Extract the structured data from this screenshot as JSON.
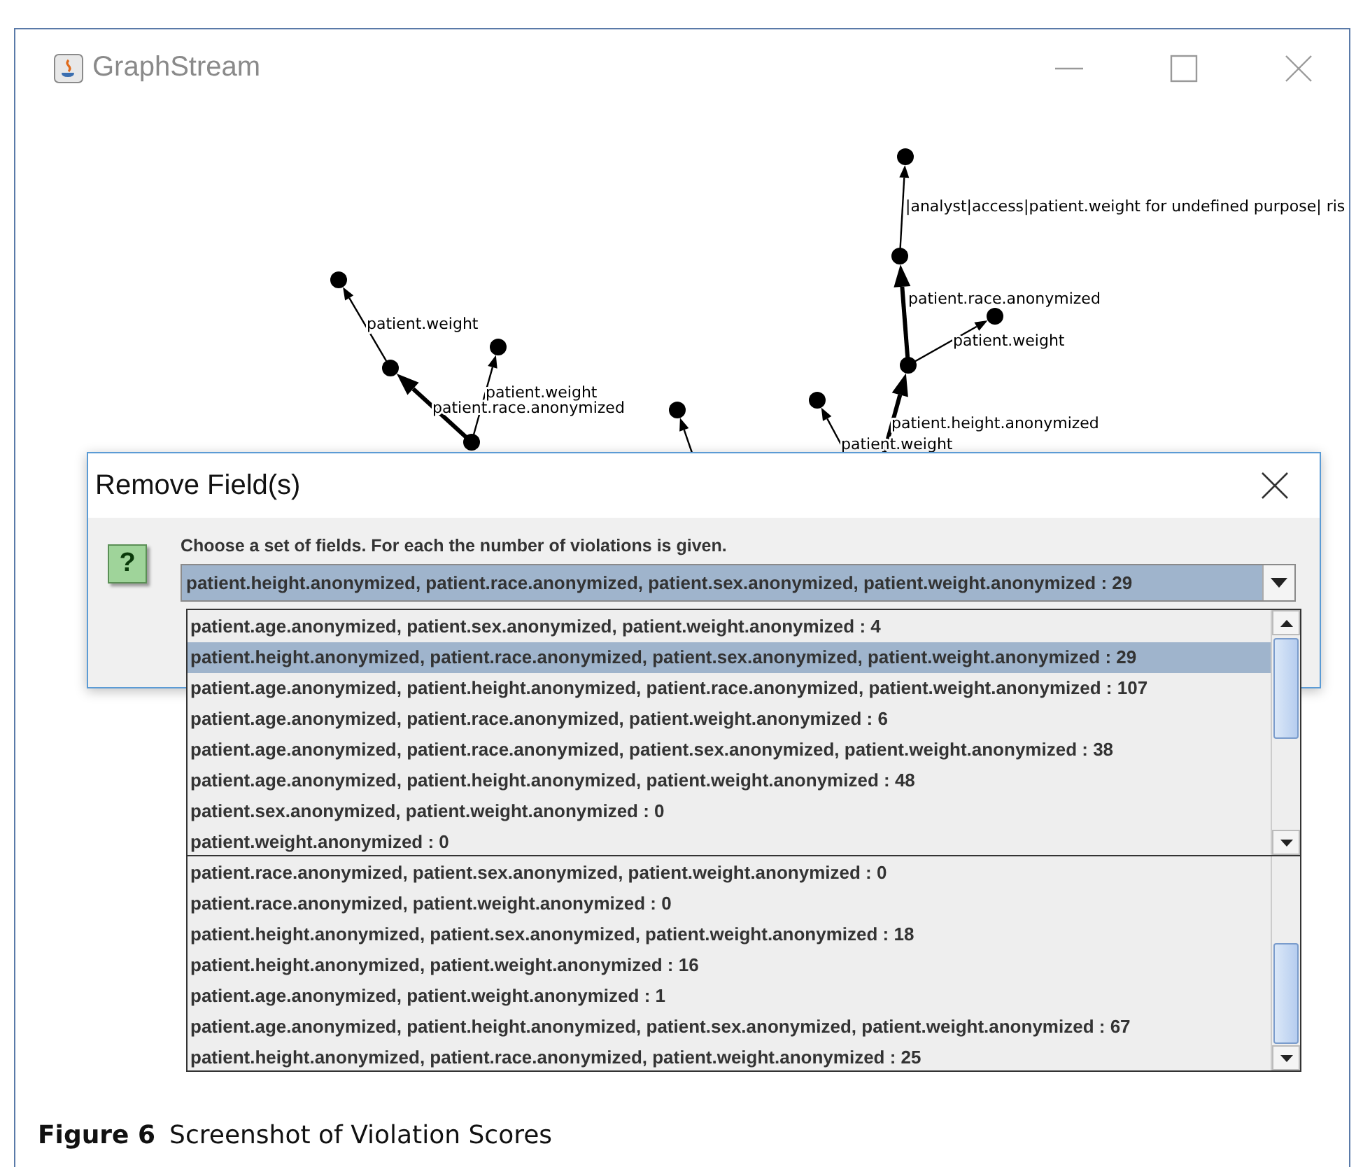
{
  "window": {
    "title": "GraphStream"
  },
  "graph": {
    "edge_labels": [
      "patient.weight",
      "patient.weight",
      "patient.race.anonymized",
      "|analyst|access|patient.weight for undefined purpose| ris",
      "patient.race.anonymized",
      "patient.weight",
      "patient.height.anonymized",
      "patient.weight"
    ]
  },
  "dialog": {
    "title": "Remove Field(s)",
    "question_icon": "?",
    "message": "Choose a set of fields. For each the number of violations is given.",
    "combo": {
      "value": "patient.height.anonymized, patient.race.anonymized, patient.sex.anonymized, patient.weight.anonymized : 29"
    }
  },
  "dropdown_list": {
    "items": [
      {
        "text": "patient.age.anonymized, patient.sex.anonymized, patient.weight.anonymized : 4",
        "selected": false
      },
      {
        "text": "patient.height.anonymized, patient.race.anonymized, patient.sex.anonymized, patient.weight.anonymized : 29",
        "selected": true
      },
      {
        "text": "patient.age.anonymized, patient.height.anonymized, patient.race.anonymized, patient.weight.anonymized : 107",
        "selected": false
      },
      {
        "text": "patient.age.anonymized, patient.race.anonymized, patient.weight.anonymized : 6",
        "selected": false
      },
      {
        "text": "patient.age.anonymized, patient.race.anonymized, patient.sex.anonymized, patient.weight.anonymized : 38",
        "selected": false
      },
      {
        "text": "patient.age.anonymized, patient.height.anonymized, patient.weight.anonymized : 48",
        "selected": false
      },
      {
        "text": "patient.sex.anonymized, patient.weight.anonymized : 0",
        "selected": false
      },
      {
        "text": "patient.weight.anonymized : 0",
        "selected": false
      }
    ]
  },
  "dropdown_list_2": {
    "items": [
      {
        "text": "patient.race.anonymized, patient.sex.anonymized, patient.weight.anonymized : 0",
        "selected": false
      },
      {
        "text": "patient.race.anonymized, patient.weight.anonymized : 0",
        "selected": false
      },
      {
        "text": "patient.height.anonymized, patient.sex.anonymized, patient.weight.anonymized : 18",
        "selected": false
      },
      {
        "text": "patient.height.anonymized, patient.weight.anonymized : 16",
        "selected": false
      },
      {
        "text": "patient.age.anonymized, patient.weight.anonymized : 1",
        "selected": false
      },
      {
        "text": "patient.age.anonymized, patient.height.anonymized, patient.sex.anonymized, patient.weight.anonymized : 67",
        "selected": false
      },
      {
        "text": "patient.height.anonymized, patient.race.anonymized, patient.weight.anonymized : 25",
        "selected": false
      }
    ]
  },
  "caption": {
    "label": "Figure 6",
    "text": "Screenshot of Violation Scores"
  }
}
